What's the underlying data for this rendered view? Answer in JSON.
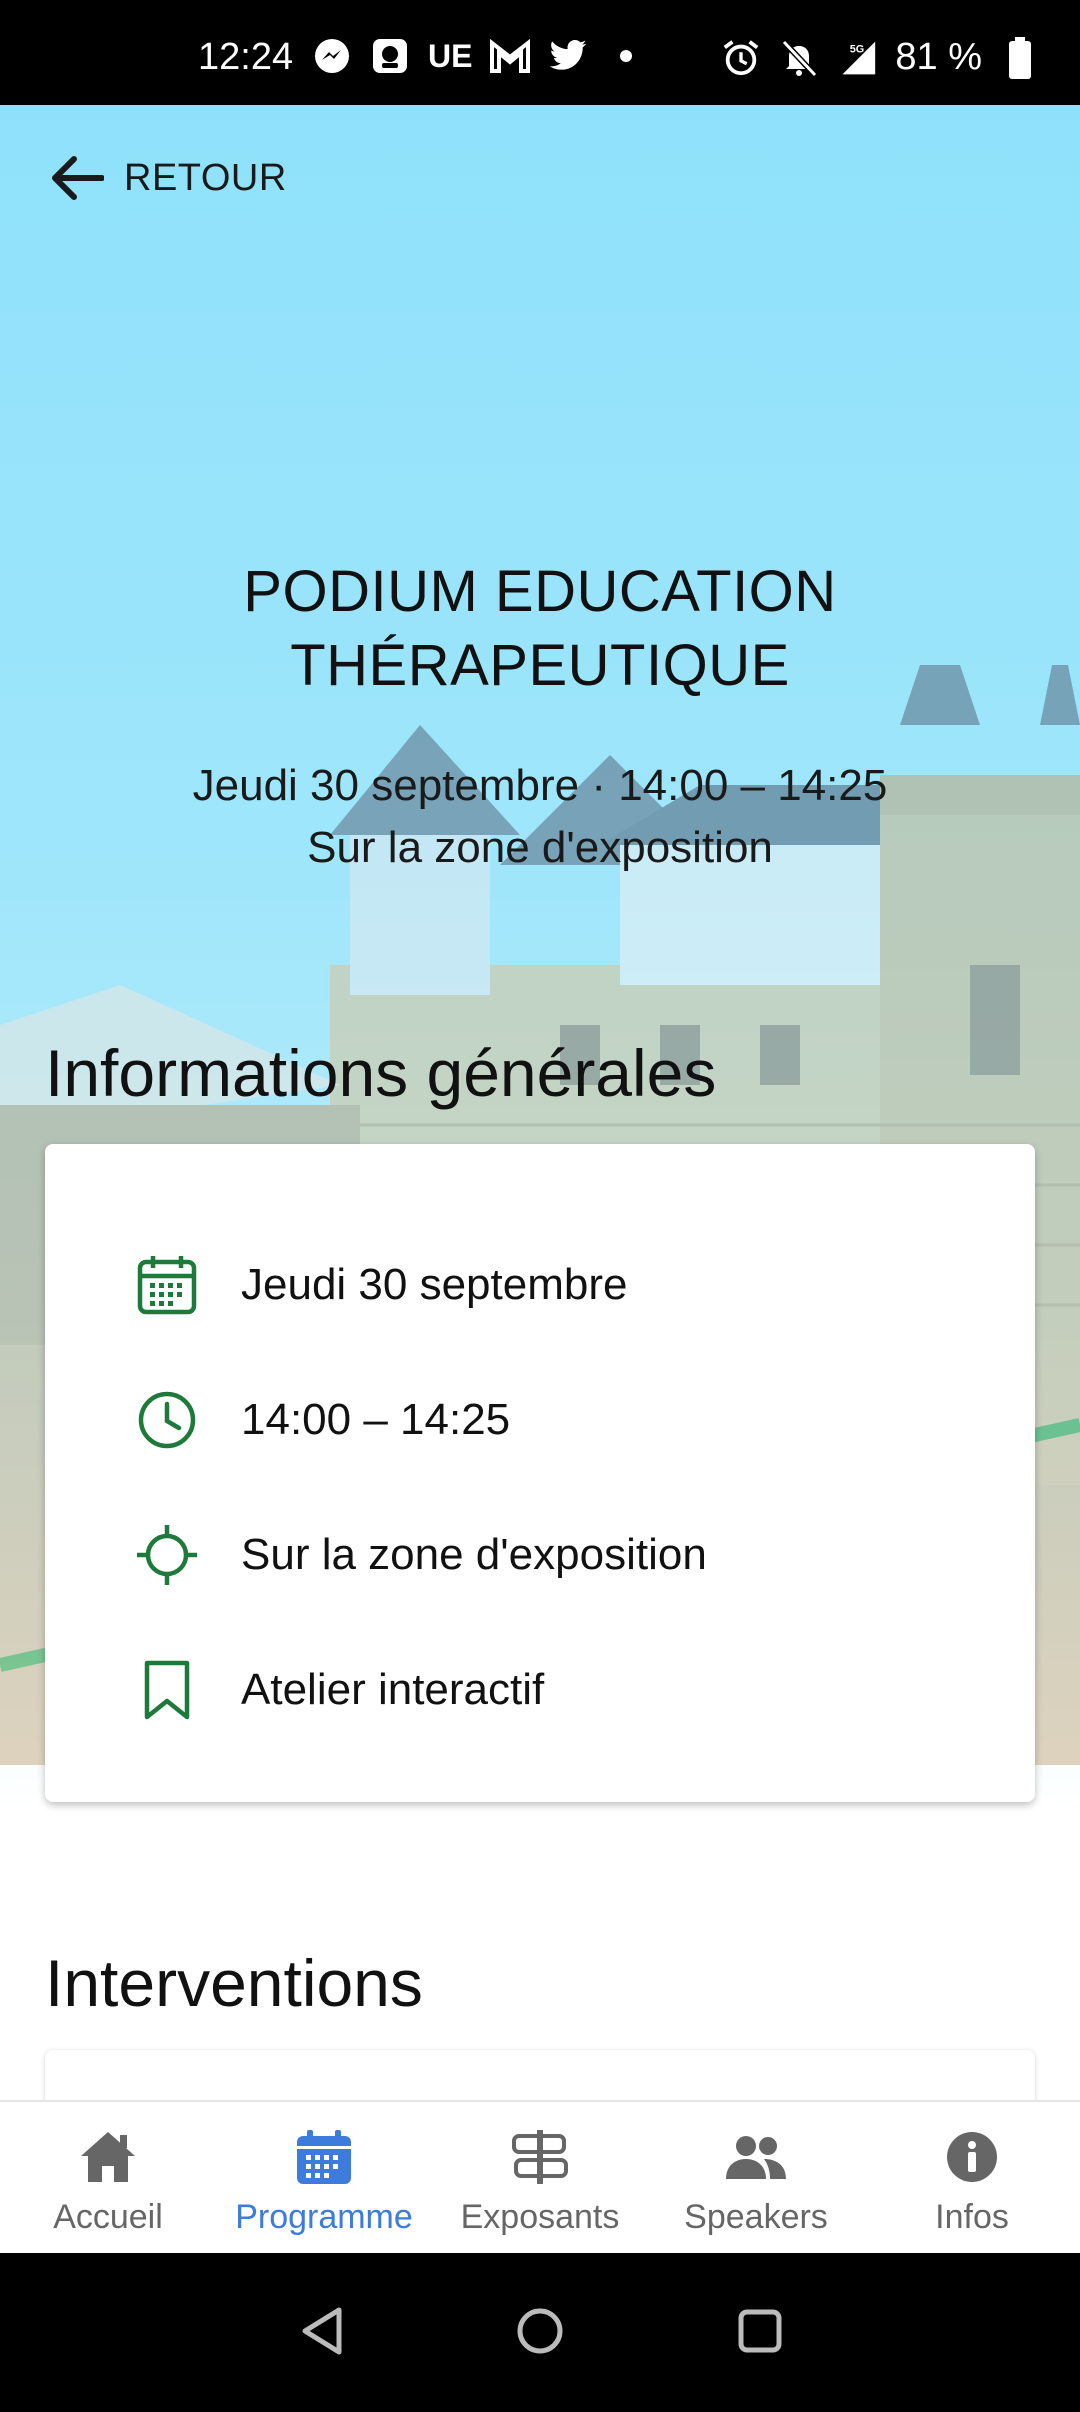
{
  "status_bar": {
    "time": "12:24",
    "ue_label": "UE",
    "network": "5G",
    "battery": "81 %"
  },
  "header": {
    "back_label": "RETOUR"
  },
  "event": {
    "title_line1": "PODIUM EDUCATION",
    "title_line2": "THÉRAPEUTIQUE",
    "datetime": "Jeudi 30 septembre · 14:00 – 14:25",
    "location": "Sur la zone d'exposition"
  },
  "sections": {
    "info_title": "Informations générales",
    "interventions_title": "Interventions"
  },
  "info": {
    "date": "Jeudi 30 septembre",
    "time": "14:00 – 14:25",
    "place": "Sur la zone d'exposition",
    "type": "Atelier interactif"
  },
  "colors": {
    "accent_green": "#1e7a3a",
    "nav_active": "#3d7bdc",
    "nav_inactive": "#666666"
  },
  "nav": {
    "items": [
      {
        "label": "Accueil",
        "icon": "home-icon"
      },
      {
        "label": "Programme",
        "icon": "calendar-icon",
        "active": true
      },
      {
        "label": "Exposants",
        "icon": "signpost-icon"
      },
      {
        "label": "Speakers",
        "icon": "people-icon"
      },
      {
        "label": "Infos",
        "icon": "info-icon"
      }
    ]
  }
}
